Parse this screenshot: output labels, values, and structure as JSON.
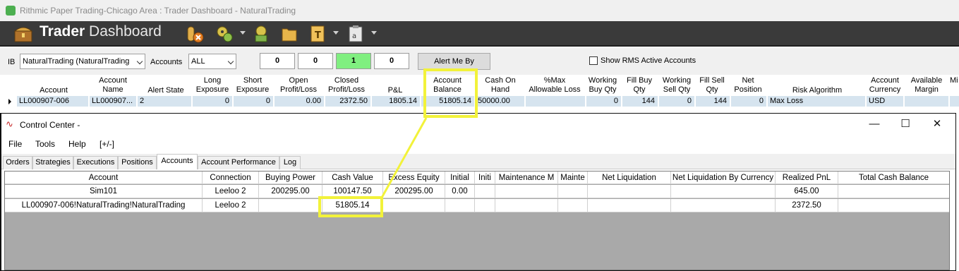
{
  "window": {
    "title": "Rithmic Paper Trading-Chicago Area : Trader Dashboard - NaturalTrading"
  },
  "toolbar": {
    "brand_bold": "Trader",
    "brand_light": "Dashboard",
    "icons": [
      "trader-chest-icon",
      "connections-icon",
      "settings-gears-icon",
      "money-gears-icon",
      "folder-icon",
      "text-doc-icon",
      "clipboard-icon"
    ]
  },
  "filter": {
    "ib_label": "IB",
    "ib_value": "NaturalTrading (NaturalTrading",
    "accounts_label": "Accounts",
    "accounts_value": "ALL",
    "counts": [
      "0",
      "0",
      "1",
      "0"
    ],
    "alert_button": "Alert Me By",
    "rms_label": "Show RMS Active Accounts"
  },
  "dashboard": {
    "headers": [
      [
        "Account"
      ],
      [
        "Account",
        "Name"
      ],
      [
        "Alert State"
      ],
      [
        "Long",
        "Exposure"
      ],
      [
        "Short",
        "Exposure"
      ],
      [
        "Open",
        "Profit/Loss"
      ],
      [
        "Closed",
        "Profit/Loss"
      ],
      [
        "P&L"
      ],
      [
        "Account",
        "Balance"
      ],
      [
        "Cash On",
        "Hand"
      ],
      [
        "%Max",
        "Allowable Loss"
      ],
      [
        "Working",
        "Buy Qty"
      ],
      [
        "Fill Buy",
        "Qty"
      ],
      [
        "Working",
        "Sell Qty"
      ],
      [
        "Fill Sell",
        "Qty"
      ],
      [
        "Net",
        "Position"
      ],
      [
        "Risk Algorithm"
      ],
      [
        "Account",
        "Currency"
      ],
      [
        "Available",
        "Margin"
      ],
      [
        "Mi"
      ]
    ],
    "row": {
      "account": "LL000907-006",
      "account_name": "LL000907...",
      "alert_state": "2",
      "long_exposure": "0",
      "short_exposure": "0",
      "open_pl": "0.00",
      "closed_pl": "2372.50",
      "pnl": "1805.14",
      "account_balance": "51805.14",
      "cash_on_hand": "50000.00",
      "max_allowable_loss": "",
      "working_buy_qty": "0",
      "fill_buy_qty": "144",
      "working_sell_qty": "0",
      "fill_sell_qty": "144",
      "net_position": "0",
      "risk_algorithm": "Max Loss",
      "currency": "USD",
      "available_margin": "",
      "mi": ""
    }
  },
  "control_center": {
    "title": "Control Center -",
    "menu": [
      "File",
      "Tools",
      "Help",
      "[+/-]"
    ],
    "tabs": [
      "Orders",
      "Strategies",
      "Executions",
      "Positions",
      "Accounts",
      "Account Performance",
      "Log"
    ],
    "active_tab": "Accounts",
    "columns": [
      "Account",
      "Connection",
      "Buying Power",
      "Cash Value",
      "Excess Equity",
      "Initial",
      "Initi",
      "Maintenance M",
      "Mainte",
      "Net Liquidation",
      "Net Liquidation By Currency",
      "Realized PnL",
      "Total Cash Balance"
    ],
    "rows": [
      [
        "Sim101",
        "Leeloo 2",
        "200295.00",
        "100147.50",
        "200295.00",
        "0.00",
        "",
        "",
        "",
        "",
        "",
        "645.00",
        ""
      ],
      [
        "LL000907-006!NaturalTrading!NaturalTrading",
        "Leeloo 2",
        "",
        "51805.14",
        "",
        "",
        "",
        "",
        "",
        "",
        "",
        "2372.50",
        ""
      ]
    ]
  },
  "annotation": {
    "color": "#f2f23a",
    "note": "Account Balance 51805.14 linked to Cash Value 51805.14"
  }
}
